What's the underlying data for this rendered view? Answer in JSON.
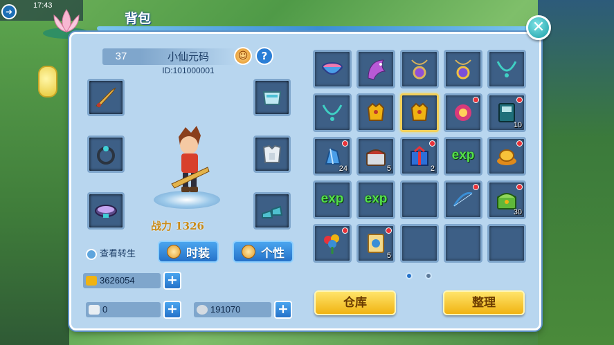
{
  "status_bar": {
    "time": "17:43"
  },
  "panel": {
    "title": "背包"
  },
  "character": {
    "level": "37",
    "name": "小仙元码",
    "id_text": "ID:101000001",
    "power_text": "战力 1326"
  },
  "actions": {
    "view_rebirth": "查看转生",
    "fashion": "时装",
    "personality": "个性"
  },
  "currency": {
    "gold": "3626054",
    "ticket": "0",
    "silver": "191070"
  },
  "inventory": {
    "rows": [
      [
        {
          "icon": "bowl-icon",
          "count": "",
          "dot": false,
          "sel": false
        },
        {
          "icon": "phoenix-icon",
          "count": "",
          "dot": false,
          "sel": false
        },
        {
          "icon": "amulet-purple-icon",
          "count": "",
          "dot": false,
          "sel": false
        },
        {
          "icon": "amulet-gold-icon",
          "count": "",
          "dot": false,
          "sel": false
        },
        {
          "icon": "necklace-icon",
          "count": "",
          "dot": false,
          "sel": false
        }
      ],
      [
        {
          "icon": "necklace-icon",
          "count": "",
          "dot": false,
          "sel": false
        },
        {
          "icon": "gold-armor-icon",
          "count": "",
          "dot": false,
          "sel": false
        },
        {
          "icon": "gold-armor-icon",
          "count": "",
          "dot": false,
          "sel": true
        },
        {
          "icon": "fire-orb-icon",
          "count": "",
          "dot": true,
          "sel": false
        },
        {
          "icon": "book-icon",
          "count": "10",
          "dot": true,
          "sel": false
        }
      ],
      [
        {
          "icon": "blue-crystal-icon",
          "count": "24",
          "dot": true,
          "sel": false
        },
        {
          "icon": "treasure-chest-icon",
          "count": "5",
          "dot": false,
          "sel": false
        },
        {
          "icon": "gift-box-icon",
          "count": "2",
          "dot": true,
          "sel": false
        },
        {
          "icon": "exp-icon",
          "count": "",
          "dot": false,
          "sel": false,
          "text": "exp"
        },
        {
          "icon": "gold-ingot-icon",
          "count": "",
          "dot": true,
          "sel": false
        }
      ],
      [
        {
          "icon": "exp-icon",
          "count": "",
          "dot": false,
          "sel": false,
          "text": "exp"
        },
        {
          "icon": "exp-icon",
          "count": "",
          "dot": false,
          "sel": false,
          "text": "exp"
        },
        {
          "icon": "",
          "count": "",
          "dot": false,
          "sel": false
        },
        {
          "icon": "bow-icon",
          "count": "",
          "dot": true,
          "sel": false
        },
        {
          "icon": "green-chest-icon",
          "count": "30",
          "dot": true,
          "sel": false
        }
      ],
      [
        {
          "icon": "rainbow-flower-icon",
          "count": "",
          "dot": true,
          "sel": false
        },
        {
          "icon": "scroll-card-icon",
          "count": "5",
          "dot": true,
          "sel": false
        },
        {
          "icon": "",
          "count": "",
          "dot": false,
          "sel": false
        },
        {
          "icon": "",
          "count": "",
          "dot": false,
          "sel": false
        },
        {
          "icon": "",
          "count": "",
          "dot": false,
          "sel": false
        }
      ]
    ],
    "page_current": 1,
    "page_total": 2
  },
  "buttons": {
    "warehouse": "仓库",
    "sort": "整理"
  },
  "colors": {
    "panel_bg": "#b8d6ef",
    "slot_bg": "#3d5f86",
    "accent_blue": "#2572c9",
    "button_yellow": "#f0b312",
    "exp_green": "#54e04a",
    "notify_red": "#e8333a"
  }
}
